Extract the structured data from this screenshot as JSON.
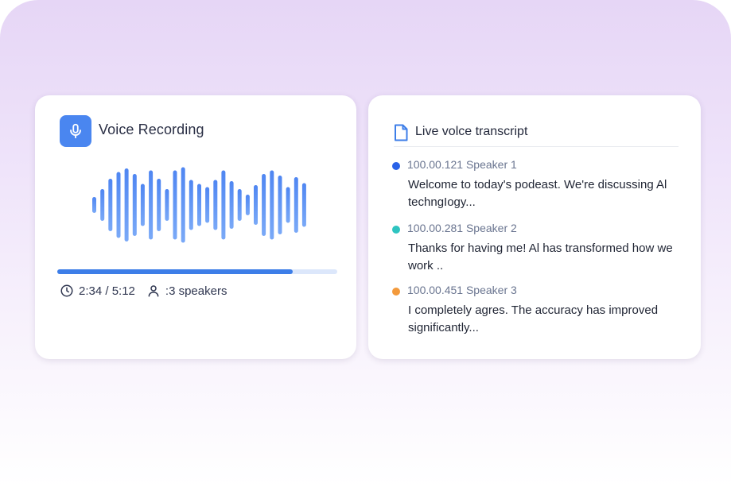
{
  "colors": {
    "accent": "#4a86f0",
    "progress": "#3d7ee8",
    "wave_top": "#4f86f2",
    "wave_bottom": "#7aa9f7"
  },
  "recording": {
    "icon": "microphone-icon",
    "title": "Voice Recording",
    "progress_fraction": 0.84,
    "time": "2:34 / 5:12",
    "speakers": ":3 speakers",
    "time_icon": "clock-icon",
    "speakers_icon": "user-icon",
    "waveform_levels": [
      0.2,
      0.4,
      0.66,
      0.83,
      0.92,
      0.78,
      0.53,
      0.87,
      0.66,
      0.4,
      0.87,
      0.95,
      0.63,
      0.53,
      0.45,
      0.63,
      0.87,
      0.6,
      0.4,
      0.26,
      0.5,
      0.78,
      0.87,
      0.74,
      0.45,
      0.7,
      0.55
    ]
  },
  "transcript": {
    "icon": "document-icon",
    "title": "Live volce transcript",
    "entries": [
      {
        "time": "100.00.121",
        "speaker": "Speaker 1",
        "color": "#2962e8",
        "text": "Welcome to today's podeast. We're discussing Al techngIogy..."
      },
      {
        "time": "100.00.281",
        "speaker": "Speaker  2",
        "color": "#2ec4c0",
        "text": "Thanks for having me! Al has transformed how we work .."
      },
      {
        "time": "100.00.451",
        "speaker": "Speaker 3",
        "color": "#f39a3c",
        "text": "I completely agres. The accuracy has improved significantly..."
      }
    ]
  }
}
